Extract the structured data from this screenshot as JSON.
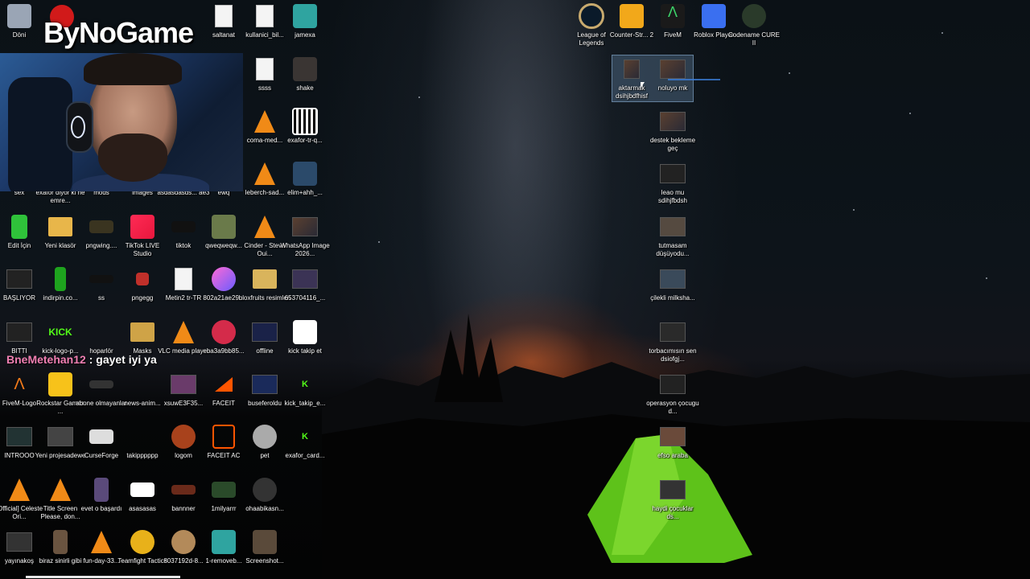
{
  "stream": {
    "logo_text": "ByNoGame",
    "chat": {
      "user": "BneMetehan12",
      "separator": " : ",
      "message": "gayet iyi ya"
    }
  },
  "desktop": {
    "icons": [
      {
        "label": "Döni",
        "icon": "recycle-bin-icon"
      },
      {
        "label": "saltanat",
        "icon": "document-icon"
      },
      {
        "label": "kullanici_bil...",
        "icon": "document-icon"
      },
      {
        "label": "jamexa",
        "icon": "image-icon"
      },
      {
        "label": "ssss",
        "icon": "document-icon"
      },
      {
        "label": "shake",
        "icon": "image-icon"
      },
      {
        "label": "coma-med...",
        "icon": "vlc-icon"
      },
      {
        "label": "exafor-tr-q...",
        "icon": "qr-image-icon"
      },
      {
        "label": "leberch-sad...",
        "icon": "vlc-icon"
      },
      {
        "label": "elim+ahh_...",
        "icon": "image-icon"
      },
      {
        "label": "sex",
        "icon": "image-icon"
      },
      {
        "label": "exafor diyor ki ne emre...",
        "icon": "image-icon"
      },
      {
        "label": "mods",
        "icon": "folder-icon"
      },
      {
        "label": "images",
        "icon": "folder-icon"
      },
      {
        "label": "asdasdasds... ae3",
        "icon": "image-icon"
      },
      {
        "label": "ewq",
        "icon": "image-icon"
      },
      {
        "label": "Edit İçin",
        "icon": "folder-icon"
      },
      {
        "label": "Yeni klasör",
        "icon": "folder-icon"
      },
      {
        "label": "pngwing....",
        "icon": "league-image-icon"
      },
      {
        "label": "TikTok LIVE Studio",
        "icon": "tiktok-icon"
      },
      {
        "label": "tiktok",
        "icon": "image-icon"
      },
      {
        "label": "qweqweqw...",
        "icon": "image-icon"
      },
      {
        "label": "Cinder - Steve Oui...",
        "icon": "vlc-icon"
      },
      {
        "label": "WhatsApp Image 2026...",
        "icon": "image-icon"
      },
      {
        "label": "BAŞLIYOR",
        "icon": "video-icon"
      },
      {
        "label": "indirpin.co...",
        "icon": "image-icon"
      },
      {
        "label": "ss",
        "icon": "image-icon"
      },
      {
        "label": "pngegg",
        "icon": "image-icon"
      },
      {
        "label": "Metin2 tr-TR",
        "icon": "document-icon"
      },
      {
        "label": "802a21ae29...",
        "icon": "image-icon"
      },
      {
        "label": "bloxfruits resimleri",
        "icon": "folder-icon"
      },
      {
        "label": "653704116_...",
        "icon": "image-icon"
      },
      {
        "label": "BITTI",
        "icon": "video-icon"
      },
      {
        "label": "kick-logo-p...",
        "icon": "kick-icon"
      },
      {
        "label": "hoparlör",
        "icon": "image-icon"
      },
      {
        "label": "Masks",
        "icon": "folder-icon"
      },
      {
        "label": "VLC media player",
        "icon": "vlc-icon"
      },
      {
        "label": "eba3a9bb85...",
        "icon": "rose-image-icon"
      },
      {
        "label": "offline",
        "icon": "image-icon"
      },
      {
        "label": "kick takip et",
        "icon": "kick-icon"
      },
      {
        "label": "FiveM-Logo",
        "icon": "fivem-icon"
      },
      {
        "label": "Rockstar Games ...",
        "icon": "rockstar-icon"
      },
      {
        "label": "abone olmayanlar",
        "icon": "image-icon"
      },
      {
        "label": "news-anim...",
        "icon": "image-icon"
      },
      {
        "label": "xsuwE3F35...",
        "icon": "image-icon"
      },
      {
        "label": "FACEIT",
        "icon": "faceit-icon"
      },
      {
        "label": "buseferoldu",
        "icon": "image-icon"
      },
      {
        "label": "kick_takip_e...",
        "icon": "kick-icon"
      },
      {
        "label": "INTROOO",
        "icon": "video-icon"
      },
      {
        "label": "Yeni projesadewe",
        "icon": "image-icon"
      },
      {
        "label": "CurseForge",
        "icon": "curseforge-icon"
      },
      {
        "label": "takipppppp",
        "icon": "image-icon"
      },
      {
        "label": "logom",
        "icon": "image-icon"
      },
      {
        "label": "FACEIT AC",
        "icon": "faceit-icon"
      },
      {
        "label": "pet",
        "icon": "image-icon"
      },
      {
        "label": "exafor_card...",
        "icon": "kick-icon"
      },
      {
        "label": "[Official] Celeste Ori...",
        "icon": "vlc-icon"
      },
      {
        "label": "Title Screen Please, don...",
        "icon": "vlc-icon"
      },
      {
        "label": "evet o başardı",
        "icon": "image-icon"
      },
      {
        "label": "asasasas",
        "icon": "image-icon"
      },
      {
        "label": "bannner",
        "icon": "image-icon"
      },
      {
        "label": "1milyarrr",
        "icon": "image-icon"
      },
      {
        "label": "ohaabikasn...",
        "icon": "image-icon"
      },
      {
        "label": "yayınakoş",
        "icon": "video-icon"
      },
      {
        "label": "biraz sinirli gibi",
        "icon": "image-icon"
      },
      {
        "label": "fun-day-33...",
        "icon": "vlc-icon"
      },
      {
        "label": "Teamfight Tactics",
        "icon": "tft-icon"
      },
      {
        "label": "8037192d-8...",
        "icon": "image-icon"
      },
      {
        "label": "1-removeb...",
        "icon": "image-icon"
      },
      {
        "label": "Screenshot...",
        "icon": "image-icon"
      },
      {
        "label": "League of Legends",
        "icon": "league-icon"
      },
      {
        "label": "Counter-Str... 2",
        "icon": "cs2-icon"
      },
      {
        "label": "FiveM",
        "icon": "fivem-icon"
      },
      {
        "label": "Roblox Player",
        "icon": "roblox-icon"
      },
      {
        "label": "Codename CURE II",
        "icon": "codename-icon"
      },
      {
        "label": "aktarmak dsihjbdfhisf",
        "icon": "video-icon"
      },
      {
        "label": "noluyo mk",
        "icon": "video-icon"
      },
      {
        "label": "destek bekleme geç",
        "icon": "video-icon"
      },
      {
        "label": "leao mu sdihjfbdsh",
        "icon": "video-icon"
      },
      {
        "label": "tutmasam düşüyodu...",
        "icon": "video-icon"
      },
      {
        "label": "çilekli milksha...",
        "icon": "video-icon"
      },
      {
        "label": "torbacımısın sen dsiofgj...",
        "icon": "video-icon"
      },
      {
        "label": "operasyon çocugu d...",
        "icon": "video-icon"
      },
      {
        "label": "efso araba",
        "icon": "video-icon"
      },
      {
        "label": "haydi çocuklar ds...",
        "icon": "video-icon"
      }
    ]
  }
}
